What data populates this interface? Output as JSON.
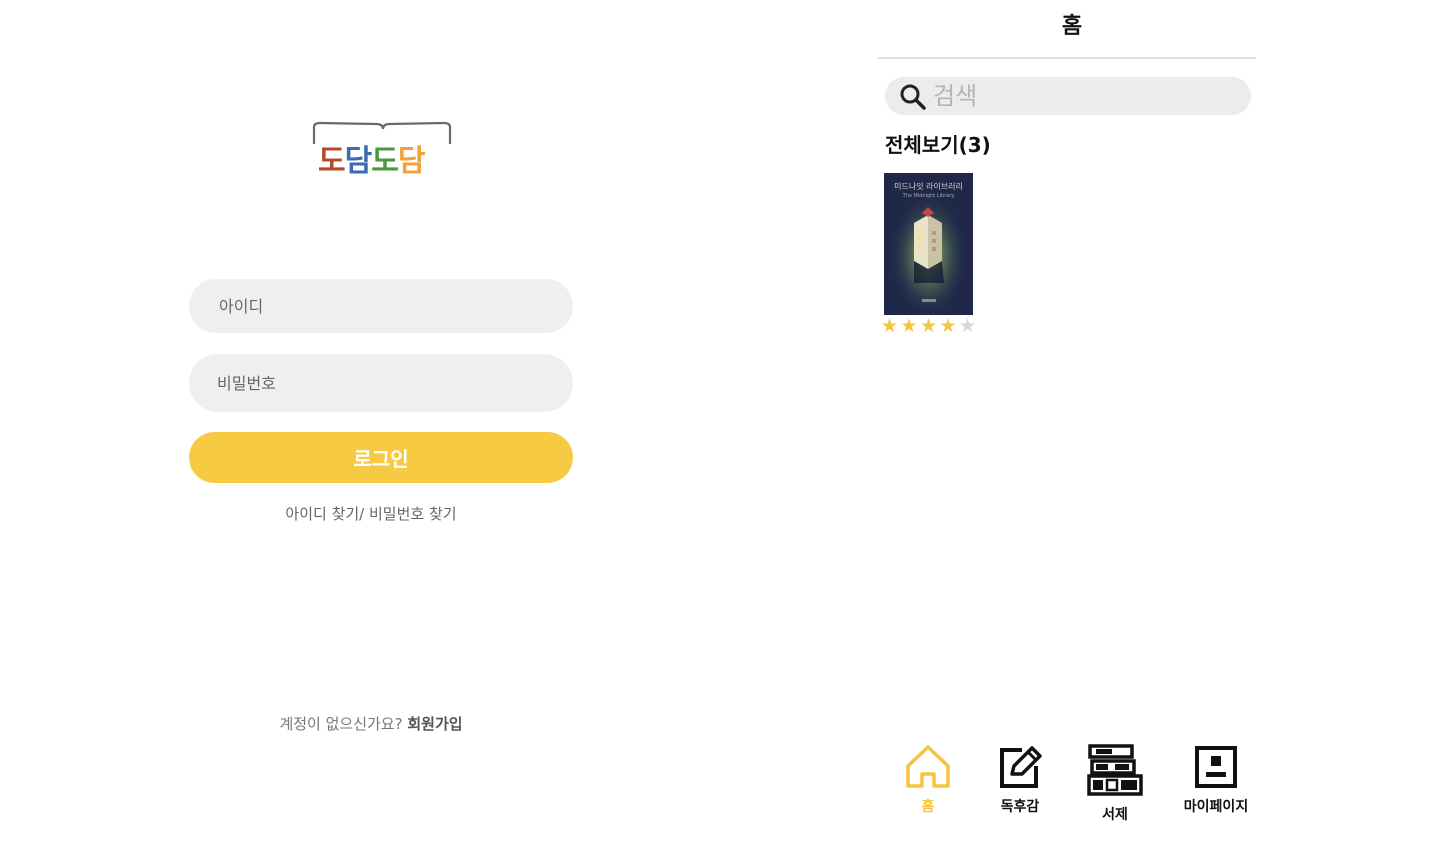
{
  "login": {
    "logo_chars": [
      "도",
      "담",
      "도",
      "담"
    ],
    "logo_colors": [
      "#b5482d",
      "#3d6bb0",
      "#4a9a3c",
      "#f0a13a"
    ],
    "id_placeholder": "아이디",
    "password_placeholder": "비밀번호",
    "login_button": "로그인",
    "find_links": "아이디 찾기/ 비밀번호 찾기",
    "signup_prompt": "계정이 없으신가요?",
    "signup_link": "회원가입"
  },
  "home": {
    "title": "홈",
    "search_placeholder": "검색",
    "section_title": "전체보기(3)",
    "books": [
      {
        "cover_title": "미드나잇 라이브러리",
        "cover_subtitle": "The Midnight Library",
        "rating": 4,
        "rating_max": 5
      }
    ]
  },
  "nav": {
    "home": "홈",
    "review": "독후감",
    "shelf": "서제",
    "mypage": "마이페이지",
    "active": "home"
  },
  "colors": {
    "accent": "#f6cb43",
    "star_on": "#f5c542",
    "star_off": "#d8d8d8",
    "field_bg": "#efefef"
  },
  "icons": {
    "search": "search-icon",
    "home": "home-icon",
    "review": "edit-note-icon",
    "shelf": "bookshelf-icon",
    "mypage": "profile-icon"
  }
}
